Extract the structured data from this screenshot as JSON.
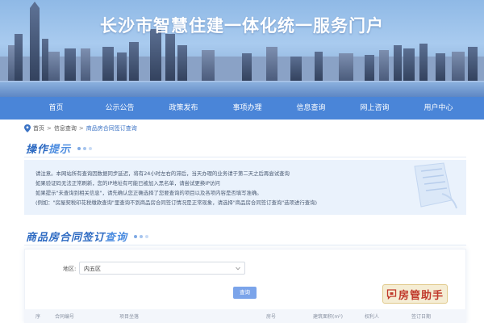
{
  "header": {
    "title": "长沙市智慧住建一体化统一服务门户"
  },
  "nav": {
    "items": [
      "首页",
      "公示公告",
      "政策发布",
      "事项办理",
      "信息查询",
      "网上咨询",
      "用户中心"
    ]
  },
  "breadcrumb": {
    "home": "首页",
    "parent": "信息查询",
    "current": "商品房合同签订查询",
    "separator": ">"
  },
  "tips_section": {
    "title_a": "操作",
    "title_b": "提示"
  },
  "notice": {
    "lines": [
      "请注意。本网站所有查询因数据同步延迟，将有24小时左右的滞后，当天办理的业务请于第二天之后再尝试查询",
      "如果验证码无法正常刷新，您的IP地址有可能已被加入黑名单，请尝试更换IP访问",
      "如果提示\"未查询到相关信息\"，请先确认您正确选择了您要查询的项目以及各项内容是否填写准确。",
      "(例如：\"房屋契税印花税缴款查询\"里查询不到商品房合同签订情况是正常现象，请选择\"商品房合同签订查询\"选项进行查询)"
    ]
  },
  "query_section": {
    "title_a": "商品房合同签订",
    "title_b": "查询"
  },
  "form": {
    "district_label": "地区:",
    "district_value": "内五区",
    "query_button": "查询"
  },
  "table": {
    "columns": [
      "序",
      "合同编号",
      "项目坐落",
      "房号",
      "建筑面积(m²)",
      "权利人",
      "签订日期"
    ]
  },
  "watermark": {
    "text": "房管助手"
  },
  "colors": {
    "nav_bg": "#4a85d8",
    "accent": "#2d6ac2",
    "notice_bg": "#eaf2fc",
    "button": "#7ba4ea"
  }
}
